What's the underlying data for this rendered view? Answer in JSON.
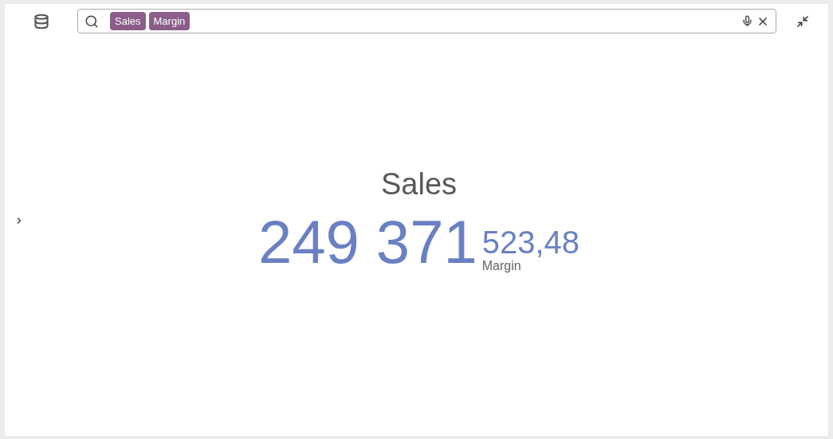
{
  "search": {
    "chips": [
      "Sales",
      "Margin"
    ]
  },
  "kpi": {
    "title": "Sales",
    "value": "249 371",
    "secondary_value": "523,48",
    "secondary_label": "Margin"
  }
}
